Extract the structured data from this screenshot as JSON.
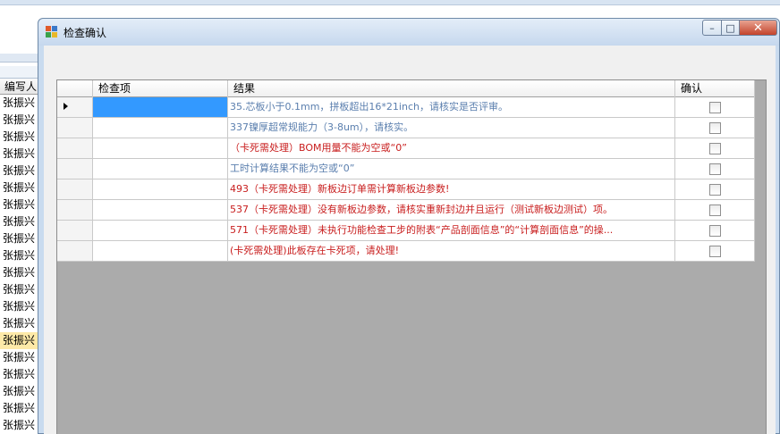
{
  "background_app": {
    "column_header": "编写人",
    "names": [
      "张振兴",
      "张振兴",
      "张振兴",
      "张振兴",
      "张振兴",
      "张振兴",
      "张振兴",
      "张振兴",
      "张振兴",
      "张振兴",
      "张振兴",
      "张振兴",
      "张振兴",
      "张振兴",
      "张振兴",
      "张振兴",
      "张振兴",
      "张振兴",
      "张振兴",
      "张振兴"
    ],
    "selected_index": 14
  },
  "dialog": {
    "title": "检查确认",
    "controls": {
      "minimize": "–",
      "maximize": "□",
      "close": "✕"
    }
  },
  "grid": {
    "columns": [
      "",
      "检查项",
      "结果",
      "确认"
    ],
    "rows": [
      {
        "item": "",
        "result": "35.芯板小于0.1mm，拼板超出16*21inch，请核实是否评审。",
        "color": "#5b7fae",
        "checked": false
      },
      {
        "item": "",
        "result": "337镍厚超常规能力（3-8um），请核实。",
        "color": "#5b7fae",
        "checked": false
      },
      {
        "item": "",
        "result": "（卡死需处理）BOM用量不能为空或“0”",
        "color": "#c81d1d",
        "checked": false
      },
      {
        "item": "",
        "result": "工时计算结果不能为空或“0”",
        "color": "#5b7fae",
        "checked": false
      },
      {
        "item": "",
        "result": "493（卡死需处理）新板边订单需计算新板边参数!",
        "color": "#c81d1d",
        "checked": false
      },
      {
        "item": "",
        "result": "537（卡死需处理）没有新板边参数，请核实重新封边并且运行（测试新板边测试）项。",
        "color": "#c81d1d",
        "checked": false
      },
      {
        "item": "",
        "result": "571（卡死需处理）未执行功能检查工步的附表“产品剖面信息”的“计算剖面信息”的操...",
        "color": "#c81d1d",
        "checked": false
      },
      {
        "item": "",
        "result": "(卡死需处理)此板存在卡死项，请处理!",
        "color": "#c81d1d",
        "checked": false
      }
    ]
  }
}
